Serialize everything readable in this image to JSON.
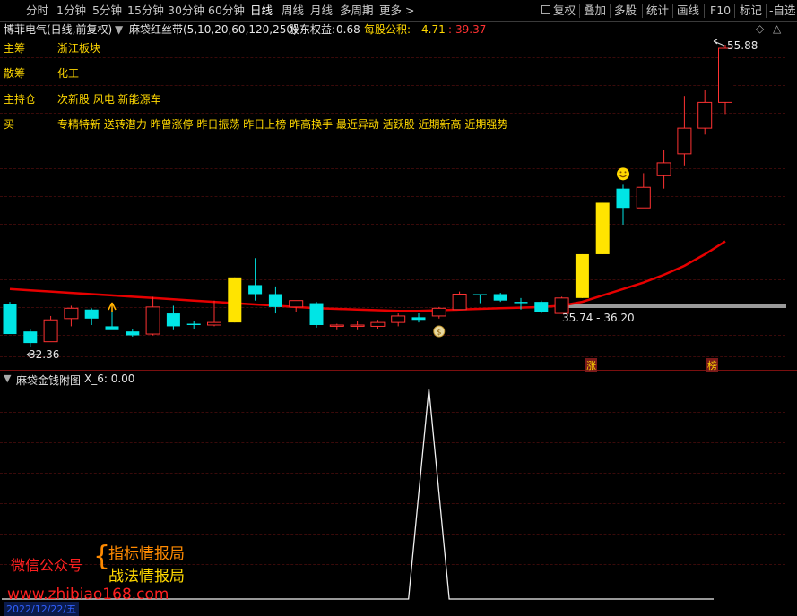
{
  "toolbar": {
    "left": [
      "分时",
      "1分钟",
      "5分钟",
      "15分钟",
      "30分钟",
      "60分钟",
      "日线",
      "周线",
      "月线",
      "多周期",
      "更多 >"
    ],
    "active": "日线",
    "right": [
      "复权",
      "叠加",
      "多股",
      "统计",
      "画线",
      "F10",
      "标记",
      "-自选"
    ]
  },
  "info": {
    "stock": "博菲电气",
    "mode": "(日线,前复权)",
    "indicator": "麻袋红丝带(5,10,20,60,120,250)",
    "equity_label": "股东权益:",
    "equity_value": "0.68",
    "accum_label": "每股公积:",
    "accum_value": "4.71",
    "sep": ":",
    "extra": "39.37"
  },
  "tags": [
    {
      "label": "主筹",
      "value": "浙江板块"
    },
    {
      "label": "散筹",
      "value": "化工"
    },
    {
      "label": "主持仓",
      "value": "次新股 风电 新能源车"
    },
    {
      "label": "买",
      "value": "专精特新 送转潜力 昨曾涨停 昨日振荡 昨日上榜 昨高换手 最近异动 活跃股 近期新高 近期强势"
    }
  ],
  "annotations": {
    "high_price": "55.88",
    "low_price": "32.36",
    "range_label": "35.74 - 36.20",
    "zhang_label": "涨",
    "bang_label": "榜"
  },
  "sub_panel": {
    "title": "麻袋金钱附图",
    "value_label": "X_6: 0.00"
  },
  "watermark": {
    "left": "微信公众号",
    "line1": "指标情报局",
    "line2": "战法情报局",
    "url": "www.zhibiao168.com",
    "date": "2022/12/22/五"
  },
  "colors": {
    "up": "#ff3232",
    "down": "#00e5e5",
    "limit": "#ffe400",
    "ma": "#e60000"
  },
  "chart_data": {
    "type": "candlestick",
    "y_range": [
      32.36,
      55.88
    ],
    "candles": [
      {
        "o": 35.7,
        "h": 35.9,
        "l": 33.4,
        "c": 33.4
      },
      {
        "o": 33.6,
        "h": 33.8,
        "l": 32.36,
        "c": 32.7
      },
      {
        "o": 32.8,
        "h": 34.8,
        "l": 32.8,
        "c": 34.5
      },
      {
        "o": 34.6,
        "h": 35.6,
        "l": 34.0,
        "c": 35.4
      },
      {
        "o": 35.3,
        "h": 35.4,
        "l": 34.1,
        "c": 34.6
      },
      {
        "o": 34.0,
        "h": 35.8,
        "l": 33.9,
        "c": 33.7
      },
      {
        "o": 33.6,
        "h": 33.8,
        "l": 33.2,
        "c": 33.3
      },
      {
        "o": 33.4,
        "h": 36.3,
        "l": 33.3,
        "c": 35.5
      },
      {
        "o": 35.0,
        "h": 35.6,
        "l": 33.7,
        "c": 34.0
      },
      {
        "o": 34.2,
        "h": 34.4,
        "l": 33.8,
        "c": 34.1
      },
      {
        "o": 34.1,
        "h": 36.0,
        "l": 34.0,
        "c": 34.3
      },
      {
        "o": 34.3,
        "h": 37.8,
        "l": 34.3,
        "c": 37.8
      },
      {
        "o": 37.2,
        "h": 39.3,
        "l": 36.0,
        "c": 36.5
      },
      {
        "o": 36.5,
        "h": 37.1,
        "l": 35.0,
        "c": 35.5
      },
      {
        "o": 35.5,
        "h": 36.0,
        "l": 35.1,
        "c": 36.0
      },
      {
        "o": 35.8,
        "h": 35.9,
        "l": 33.9,
        "c": 34.1
      },
      {
        "o": 34.0,
        "h": 34.2,
        "l": 33.7,
        "c": 34.1
      },
      {
        "o": 34.0,
        "h": 34.4,
        "l": 33.7,
        "c": 34.1
      },
      {
        "o": 34.0,
        "h": 34.5,
        "l": 33.8,
        "c": 34.3
      },
      {
        "o": 34.3,
        "h": 35.0,
        "l": 34.0,
        "c": 34.8
      },
      {
        "o": 34.7,
        "h": 35.0,
        "l": 34.3,
        "c": 34.5
      },
      {
        "o": 34.8,
        "h": 35.5,
        "l": 34.6,
        "c": 35.4
      },
      {
        "o": 35.3,
        "h": 36.7,
        "l": 35.3,
        "c": 36.5
      },
      {
        "o": 36.5,
        "h": 36.5,
        "l": 35.8,
        "c": 36.4
      },
      {
        "o": 36.5,
        "h": 36.6,
        "l": 35.9,
        "c": 36.0
      },
      {
        "o": 35.9,
        "h": 36.2,
        "l": 35.3,
        "c": 35.8
      },
      {
        "o": 35.9,
        "h": 36.0,
        "l": 35.0,
        "c": 35.1
      },
      {
        "o": 35.0,
        "h": 36.3,
        "l": 35.0,
        "c": 36.2
      },
      {
        "o": 36.2,
        "h": 39.6,
        "l": 36.2,
        "c": 39.6
      },
      {
        "o": 39.6,
        "h": 43.6,
        "l": 39.6,
        "c": 43.6
      },
      {
        "o": 44.7,
        "h": 45.0,
        "l": 41.9,
        "c": 43.2
      },
      {
        "o": 43.2,
        "h": 45.9,
        "l": 43.2,
        "c": 44.8
      },
      {
        "o": 45.7,
        "h": 47.7,
        "l": 44.7,
        "c": 46.7
      },
      {
        "o": 47.4,
        "h": 51.9,
        "l": 46.5,
        "c": 49.4
      },
      {
        "o": 49.4,
        "h": 52.4,
        "l": 48.9,
        "c": 51.4
      },
      {
        "o": 51.4,
        "h": 55.88,
        "l": 50.5,
        "c": 55.6
      }
    ],
    "ma": [
      36.9,
      36.8,
      36.7,
      36.6,
      36.5,
      36.4,
      36.3,
      36.2,
      36.1,
      36.0,
      35.9,
      35.8,
      35.7,
      35.6,
      35.5,
      35.4,
      35.35,
      35.3,
      35.25,
      35.2,
      35.2,
      35.25,
      35.3,
      35.35,
      35.4,
      35.45,
      35.5,
      35.6,
      35.9,
      36.4,
      36.9,
      37.4,
      38.0,
      38.7,
      39.6,
      40.6
    ],
    "sub_values": [
      0,
      0,
      0,
      0,
      0,
      0,
      0,
      0,
      0,
      0,
      0,
      0,
      0,
      0,
      0,
      0,
      0,
      0,
      0,
      0,
      0,
      1,
      0,
      0,
      0,
      0,
      0,
      0,
      0,
      0,
      0,
      0,
      0,
      0,
      0,
      0
    ]
  }
}
